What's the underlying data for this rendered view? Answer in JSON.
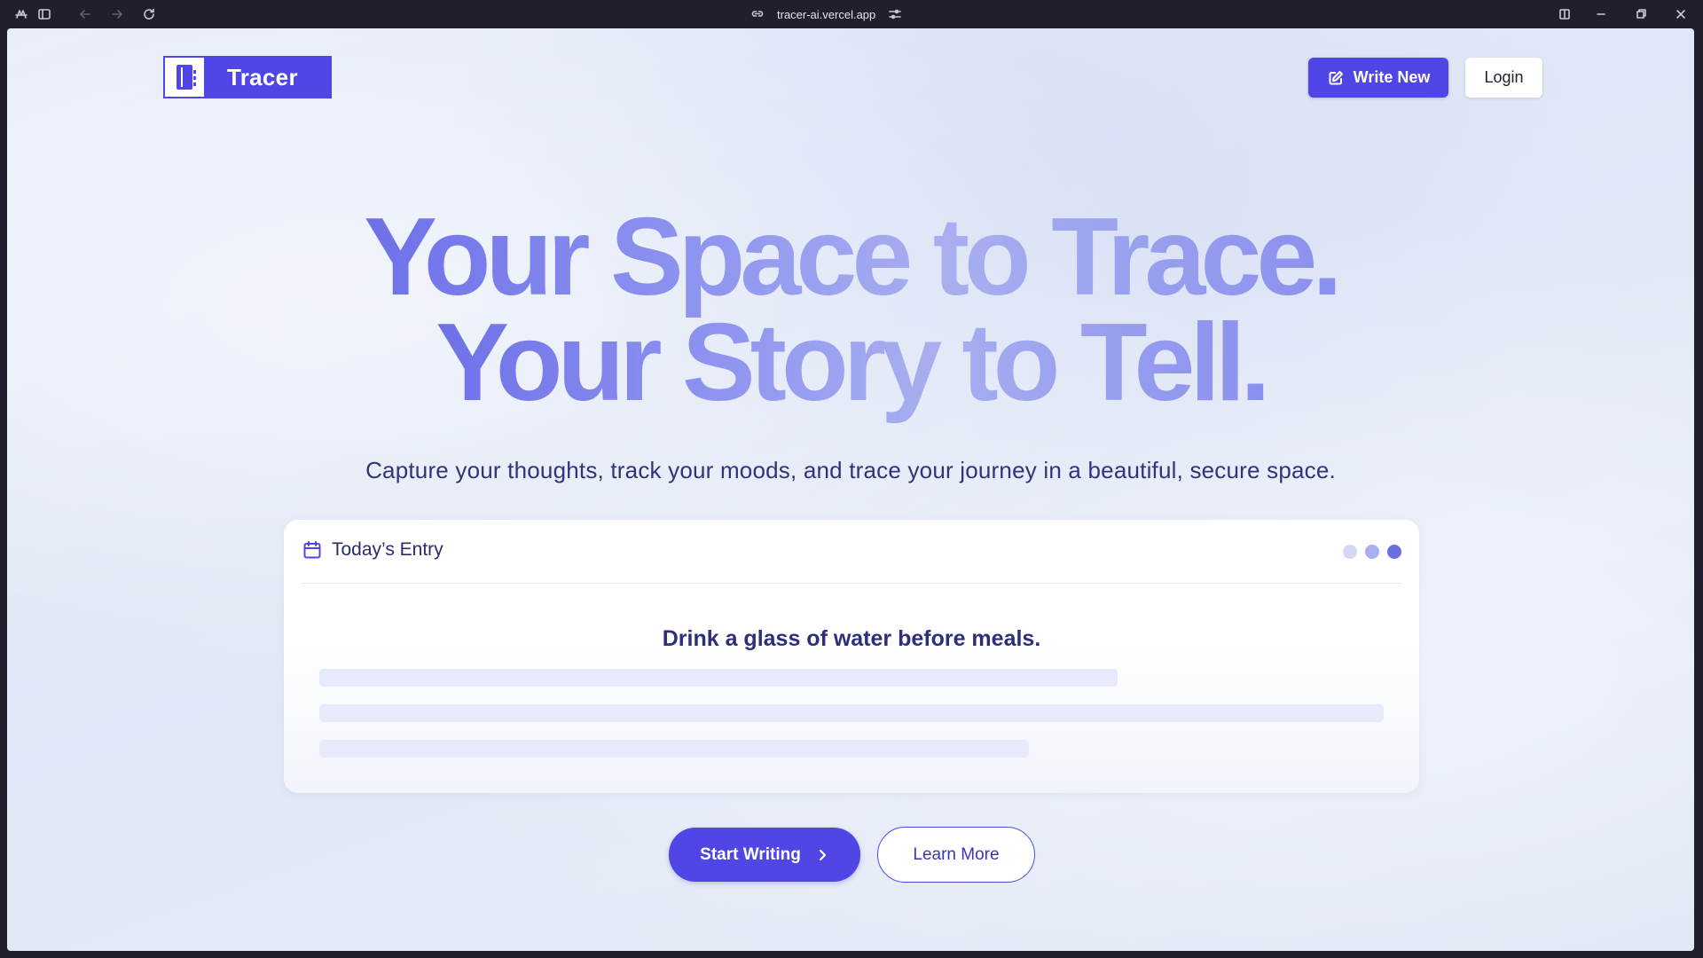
{
  "browser": {
    "url": "tracer-ai.vercel.app",
    "icons": [
      "app-menu-icon",
      "sidebar-toggle-icon",
      "back-icon",
      "forward-icon",
      "reload-icon",
      "link-icon",
      "site-settings-icon",
      "split-view-icon",
      "minimize-icon",
      "maximize-icon",
      "close-icon"
    ]
  },
  "header": {
    "logo_text": "Tracer",
    "write_new_label": "Write New",
    "login_label": "Login"
  },
  "hero": {
    "headline_line1": "Your Space to Trace.",
    "headline_line2": "Your Story to Tell.",
    "subtitle": "Capture your thoughts, track your moods, and trace your journey in a beautiful, secure space."
  },
  "entry_card": {
    "title": "Today’s Entry",
    "prompt": "Drink a glass of water before meals.",
    "dot_colors": [
      "#d4d8f7",
      "#a9aef1",
      "#6b6fe3"
    ]
  },
  "cta": {
    "start_label": "Start Writing",
    "learn_label": "Learn More"
  },
  "colors": {
    "accent": "#4f46e5",
    "text_dark": "#2e2e7a",
    "background": "#e2e8f6"
  }
}
